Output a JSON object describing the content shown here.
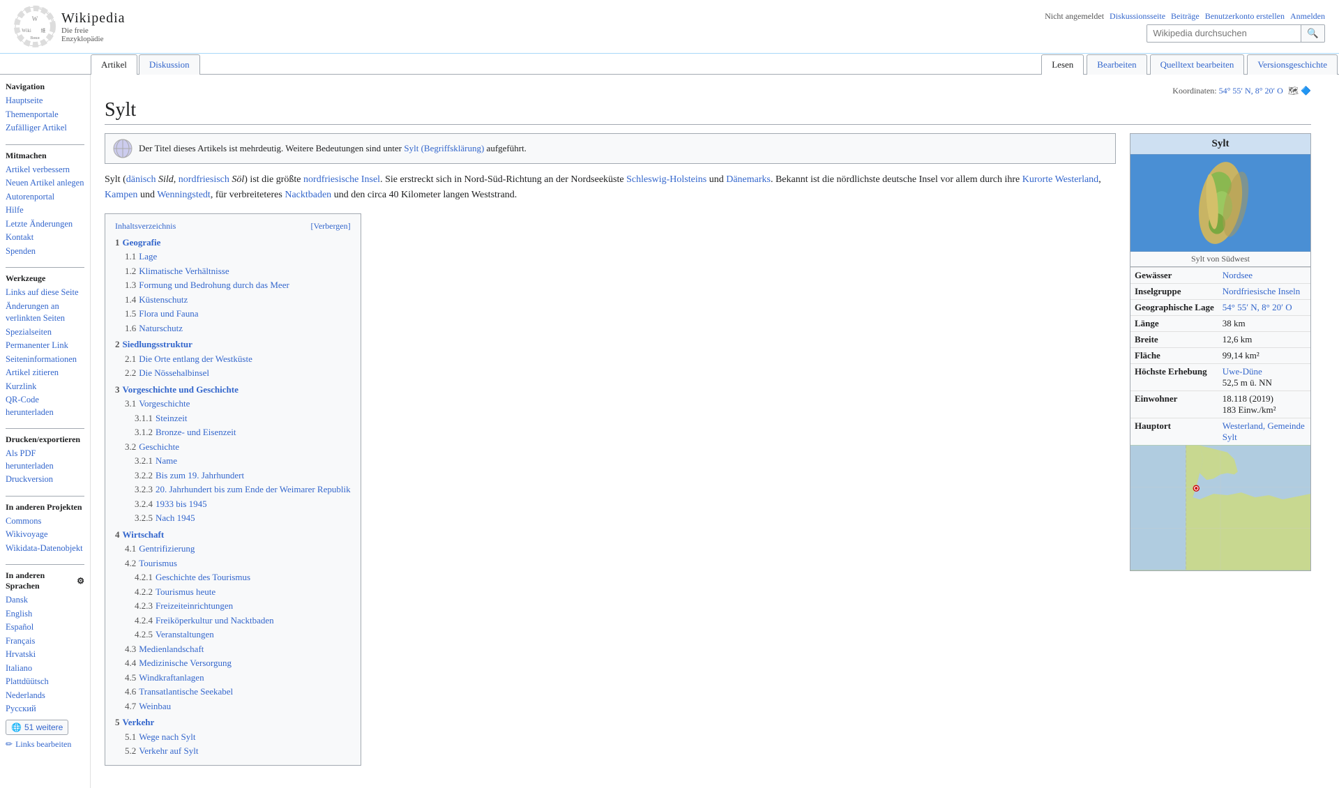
{
  "header": {
    "logo_wikipedia": "Wikipedia",
    "logo_tagline": "Die freie Enzyklopädie",
    "search_placeholder": "Wikipedia durchsuchen",
    "search_button": "🔍",
    "user_links": {
      "not_logged_in": "Nicht angemeldet",
      "discussion": "Diskussionsseite",
      "contributions": "Beiträge",
      "create_account": "Benutzerkonto erstellen",
      "login": "Anmelden"
    }
  },
  "tabs": {
    "article": "Artikel",
    "discussion": "Diskussion",
    "read": "Lesen",
    "edit": "Bearbeiten",
    "edit_source": "Quelltext bearbeiten",
    "history": "Versionsgeschichte"
  },
  "sidebar": {
    "navigation_title": "Navigation",
    "main_page": "Hauptseite",
    "thematic_portal": "Themenportale",
    "random_article": "Zufälliger Artikel",
    "participate_title": "Mitmachen",
    "improve_article": "Artikel verbessern",
    "new_article": "Neuen Artikel anlegen",
    "author_portal": "Autorenportal",
    "help": "Hilfe",
    "last_changes": "Letzte Änderungen",
    "contact": "Kontakt",
    "donate": "Spenden",
    "tools_title": "Werkzeuge",
    "links_here": "Links auf diese Seite",
    "related_changes": "Änderungen an verlinkten Seiten",
    "special_pages": "Spezialseiten",
    "permanent_link": "Permanenter Link",
    "page_info": "Seiteninformationen",
    "cite_article": "Artikel zitieren",
    "short_link": "Kurzlink",
    "qr_code": "QR-Code herunterladen",
    "print_title": "Drucken/exportieren",
    "download_pdf": "Als PDF herunterladen",
    "print_version": "Druckversion",
    "other_projects_title": "In anderen Projekten",
    "commons": "Commons",
    "wikivoyage": "Wikivoyage",
    "wikidata": "Wikidata-Datenobjekt",
    "other_languages_title": "In anderen Sprachen",
    "dansk": "Dansk",
    "english": "English",
    "espanol": "Español",
    "francais": "Français",
    "hrvatski": "Hrvatski",
    "italiano": "Italiano",
    "plattdeutsch": "Plattdüütsch",
    "nederlands": "Nederlands",
    "russian": "Русский",
    "more_languages": "51 weitere",
    "edit_links": "Links bearbeiten"
  },
  "page": {
    "title": "Sylt",
    "coords": "54° 55′ N, 8° 20′ O",
    "disambig_notice": "Der Titel dieses Artikels ist mehrdeutig. Weitere Bedeutungen sind unter",
    "disambig_link": "Sylt (Begriffsklärung)",
    "disambig_suffix": "aufgeführt.",
    "intro": "Sylt (dänisch Sild, nordfriesisch Söl) ist die größte nordfriesische Insel. Sie erstreckt sich in Nord-Süd-Richtung an der Nordseeküste Schleswig-Holsteins und Dänemarks. Bekannt ist die nördlichste deutsche Insel vor allem durch ihre Kurorte Westerland, Kampen und Wenningstedt, für verbreiteteres Nacktbaden und den circa 40 Kilometer langen Weststrand."
  },
  "infobox": {
    "title": "Sylt",
    "image_caption": "Sylt von Südwest",
    "rows": [
      {
        "label": "Gewässer",
        "value": "Nordsee",
        "link": true
      },
      {
        "label": "Inselgruppe",
        "value": "Nordfriesische Inseln",
        "link": true
      },
      {
        "label": "Geographische Lage",
        "value": "54° 55′ N, 8° 20′ O",
        "link": true
      },
      {
        "label": "Länge",
        "value": "38 km"
      },
      {
        "label": "Breite",
        "value": "12,6 km"
      },
      {
        "label": "Fläche",
        "value": "99,14 km²"
      },
      {
        "label": "Höchste Erhebung",
        "value": "Uwe-Düne\n52,5 m ü. NN",
        "link": true
      },
      {
        "label": "Einwohner",
        "value": "18.118 (2019)\n183 Einw./km²"
      },
      {
        "label": "Hauptort",
        "value": "Westerland, Gemeinde Sylt",
        "link": true
      }
    ]
  },
  "toc": {
    "title": "Inhaltsverzeichnis",
    "toggle": "[Verbergen]",
    "items": [
      {
        "num": "1",
        "label": "Geografie",
        "level": 1
      },
      {
        "num": "1.1",
        "label": "Lage",
        "level": 2
      },
      {
        "num": "1.2",
        "label": "Klimatische Verhältnisse",
        "level": 2
      },
      {
        "num": "1.3",
        "label": "Formung und Bedrohung durch das Meer",
        "level": 2
      },
      {
        "num": "1.4",
        "label": "Küstenschutz",
        "level": 2
      },
      {
        "num": "1.5",
        "label": "Flora und Fauna",
        "level": 2
      },
      {
        "num": "1.6",
        "label": "Naturschutz",
        "level": 2
      },
      {
        "num": "2",
        "label": "Siedlungsstruktur",
        "level": 1
      },
      {
        "num": "2.1",
        "label": "Die Orte entlang der Westküste",
        "level": 2
      },
      {
        "num": "2.2",
        "label": "Die Nössehalbinsel",
        "level": 2
      },
      {
        "num": "3",
        "label": "Vorgeschichte und Geschichte",
        "level": 1
      },
      {
        "num": "3.1",
        "label": "Vorgeschichte",
        "level": 2
      },
      {
        "num": "3.1.1",
        "label": "Steinzeit",
        "level": 3
      },
      {
        "num": "3.1.2",
        "label": "Bronze- und Eisenzeit",
        "level": 3
      },
      {
        "num": "3.2",
        "label": "Geschichte",
        "level": 2
      },
      {
        "num": "3.2.1",
        "label": "Name",
        "level": 3
      },
      {
        "num": "3.2.2",
        "label": "Bis zum 19. Jahrhundert",
        "level": 3
      },
      {
        "num": "3.2.3",
        "label": "20. Jahrhundert bis zum Ende der Weimarer Republik",
        "level": 3
      },
      {
        "num": "3.2.4",
        "label": "1933 bis 1945",
        "level": 3
      },
      {
        "num": "3.2.5",
        "label": "Nach 1945",
        "level": 3
      },
      {
        "num": "4",
        "label": "Wirtschaft",
        "level": 1
      },
      {
        "num": "4.1",
        "label": "Gentrifizierung",
        "level": 2
      },
      {
        "num": "4.2",
        "label": "Tourismus",
        "level": 2
      },
      {
        "num": "4.2.1",
        "label": "Geschichte des Tourismus",
        "level": 3
      },
      {
        "num": "4.2.2",
        "label": "Tourismus heute",
        "level": 3
      },
      {
        "num": "4.2.3",
        "label": "Freizeiteinrichtungen",
        "level": 3
      },
      {
        "num": "4.2.4",
        "label": "Freiköperkultur und Nacktbaden",
        "level": 3
      },
      {
        "num": "4.2.5",
        "label": "Veranstaltungen",
        "level": 3
      },
      {
        "num": "4.3",
        "label": "Medienlandschaft",
        "level": 2
      },
      {
        "num": "4.4",
        "label": "Medizinische Versorgung",
        "level": 2
      },
      {
        "num": "4.5",
        "label": "Windkraftanlagen",
        "level": 2
      },
      {
        "num": "4.6",
        "label": "Transatlantische Seekabel",
        "level": 2
      },
      {
        "num": "4.7",
        "label": "Weinbau",
        "level": 2
      },
      {
        "num": "5",
        "label": "Verkehr",
        "level": 1
      },
      {
        "num": "5.1",
        "label": "Wege nach Sylt",
        "level": 2
      },
      {
        "num": "5.2",
        "label": "Verkehr auf Sylt",
        "level": 2
      }
    ]
  }
}
